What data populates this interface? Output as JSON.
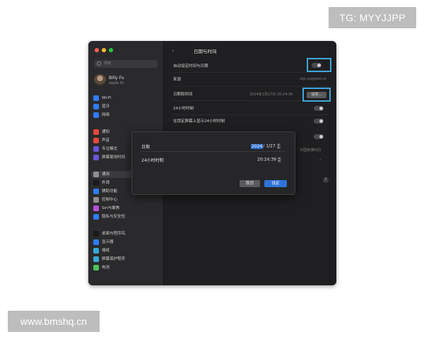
{
  "watermarks": {
    "tg": "TG: MYYJJPP",
    "site": "www.bmshq.cn"
  },
  "window": {
    "traffic_colors": [
      "#fe5f57",
      "#febc2e",
      "#28c840"
    ]
  },
  "sidebar": {
    "search_placeholder": "搜索",
    "account": {
      "name": "Billy Fu",
      "sub": "Apple ID"
    },
    "items": [
      {
        "label": "Wi-Fi",
        "icon": "wifi-icon",
        "color": "#2f7cf6"
      },
      {
        "label": "蓝牙",
        "icon": "bluetooth-icon",
        "color": "#2f7cf6"
      },
      {
        "label": "网络",
        "icon": "network-icon",
        "color": "#2f7cf6"
      },
      {
        "label": "通知",
        "icon": "bell-icon",
        "color": "#e5483c"
      },
      {
        "label": "声音",
        "icon": "speaker-icon",
        "color": "#e5483c"
      },
      {
        "label": "专注模式",
        "icon": "moon-icon",
        "color": "#6856d8"
      },
      {
        "label": "屏幕使用时间",
        "icon": "hourglass-icon",
        "color": "#6856d8"
      },
      {
        "label": "通用",
        "icon": "gear-icon",
        "color": "#8e8e93"
      },
      {
        "label": "外观",
        "icon": "appearance-icon",
        "color": "#1a1a1a"
      },
      {
        "label": "辅助功能",
        "icon": "accessibility-icon",
        "color": "#2f7cf6"
      },
      {
        "label": "控制中心",
        "icon": "control-center-icon",
        "color": "#8e8e93"
      },
      {
        "label": "Siri与聚焦",
        "icon": "siri-icon",
        "color": "#b94fd6"
      },
      {
        "label": "隐私与安全性",
        "icon": "hand-icon",
        "color": "#2f7cf6"
      },
      {
        "label": "桌面与程序坞",
        "icon": "dock-icon",
        "color": "#1a1a1a"
      },
      {
        "label": "显示器",
        "icon": "display-icon",
        "color": "#2f7cf6"
      },
      {
        "label": "墙纸",
        "icon": "wallpaper-icon",
        "color": "#36a9d8"
      },
      {
        "label": "屏幕保护程序",
        "icon": "screensaver-icon",
        "color": "#36a9d8"
      },
      {
        "label": "电池",
        "icon": "battery-icon",
        "color": "#4cc35a"
      }
    ]
  },
  "main": {
    "title": "日期与时间",
    "rows": {
      "auto_set": {
        "label": "自动设定时间与日期"
      },
      "source": {
        "label": "来源",
        "value": "ntp.xyzgeek.cn"
      },
      "date_time": {
        "label": "日期和时间",
        "value": "2024年1月27日 20:24:39",
        "button": "设定..."
      },
      "h24": {
        "label": "24小时时制"
      },
      "lock_24": {
        "label": "在锁定屏幕上显示24小时时制"
      },
      "tz_value": "中国标准时间"
    }
  },
  "dialog": {
    "date_label": "日期",
    "date_year": "2024",
    "date_rest": "/ 1/27",
    "time_label": "24小时时制",
    "time_value": "20:24:39",
    "cancel": "取消",
    "ok": "设定"
  }
}
